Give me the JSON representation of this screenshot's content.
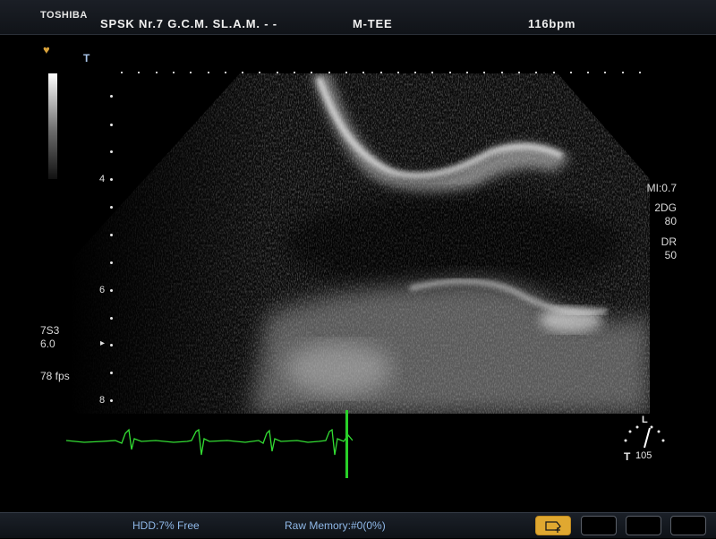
{
  "header": {
    "brand": "TOSHIBA",
    "institution": "SPSK Nr.7 G.C.M. SL.A.M.  -  -",
    "probe_mode": "M-TEE",
    "heart_rate": "116bpm"
  },
  "left_panel": {
    "depth_labels": [
      "4",
      "6",
      "8"
    ],
    "transducer": "7S3",
    "frequency": "6.0",
    "frame_rate": "78 fps",
    "focus_marker": "▸"
  },
  "right_panel": {
    "mi": "MI:0.7",
    "gain_label": "2DG",
    "gain_value": "80",
    "dr_label": "DR",
    "dr_value": "50"
  },
  "orientation": {
    "top_label": "L",
    "bottom_label": "T",
    "angle": "105"
  },
  "statusbar": {
    "hdd": "HDD:7% Free",
    "raw_memory": "Raw Memory:#0(0%)"
  },
  "icons": {
    "heart": "heart-icon",
    "trackball": "trackball-icon",
    "tmark": "T"
  },
  "colors": {
    "ecg": "#33dd33",
    "accent": "#e0a830",
    "status_text": "#8fb8e8"
  }
}
